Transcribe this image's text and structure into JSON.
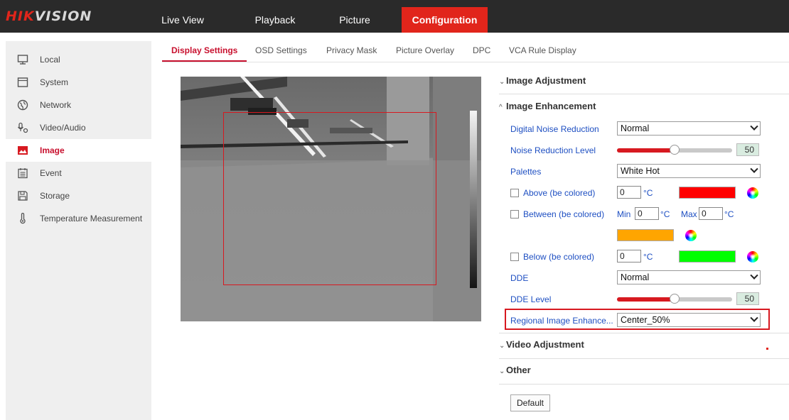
{
  "brand": {
    "part1": "HIK",
    "part2": "VISION"
  },
  "nav": [
    {
      "label": "Live View"
    },
    {
      "label": "Playback"
    },
    {
      "label": "Picture"
    },
    {
      "label": "Configuration"
    }
  ],
  "sidebar": [
    {
      "label": "Local",
      "icon": "monitor-icon"
    },
    {
      "label": "System",
      "icon": "window-icon"
    },
    {
      "label": "Network",
      "icon": "globe-icon"
    },
    {
      "label": "Video/Audio",
      "icon": "microphone-icon"
    },
    {
      "label": "Image",
      "icon": "image-icon"
    },
    {
      "label": "Event",
      "icon": "calendar-icon"
    },
    {
      "label": "Storage",
      "icon": "floppy-icon"
    },
    {
      "label": "Temperature Measurement",
      "icon": "thermometer-icon"
    }
  ],
  "subtabs": [
    {
      "label": "Display Settings"
    },
    {
      "label": "OSD Settings"
    },
    {
      "label": "Privacy Mask"
    },
    {
      "label": "Picture Overlay"
    },
    {
      "label": "DPC"
    },
    {
      "label": "VCA Rule Display"
    }
  ],
  "panel": {
    "image_adjustment": "Image Adjustment",
    "image_enhancement": "Image Enhancement",
    "video_adjustment": "Video Adjustment",
    "other": "Other",
    "chevron_collapsed": "⌄",
    "chevron_expanded": "^",
    "dnr_label": "Digital Noise Reduction",
    "dnr_value": "Normal",
    "nrl_label": "Noise Reduction Level",
    "nrl_value": "50",
    "nrl_fraction": 0.5,
    "palettes_label": "Palettes",
    "palettes_value": "White Hot",
    "above_label": "Above (be colored)",
    "above_value": "0",
    "above_color": "#ff0000",
    "between_label": "Between (be colored)",
    "min_label": "Min",
    "min_value": "0",
    "max_label": "Max",
    "max_value": "0",
    "between_color": "#ffa500",
    "below_label": "Below (be colored)",
    "below_value": "0",
    "below_color": "#00ff00",
    "unit": "°C",
    "dde_label": "DDE",
    "dde_value": "Normal",
    "dde_level_label": "DDE Level",
    "dde_level_value": "50",
    "dde_level_fraction": 0.5,
    "regional_label": "Regional Image Enhance...",
    "regional_value": "Center_50%",
    "default_button": "Default"
  },
  "colors": {
    "accent": "#e1251b",
    "link": "#1e4fc2",
    "topbar": "#2a2a2a"
  }
}
